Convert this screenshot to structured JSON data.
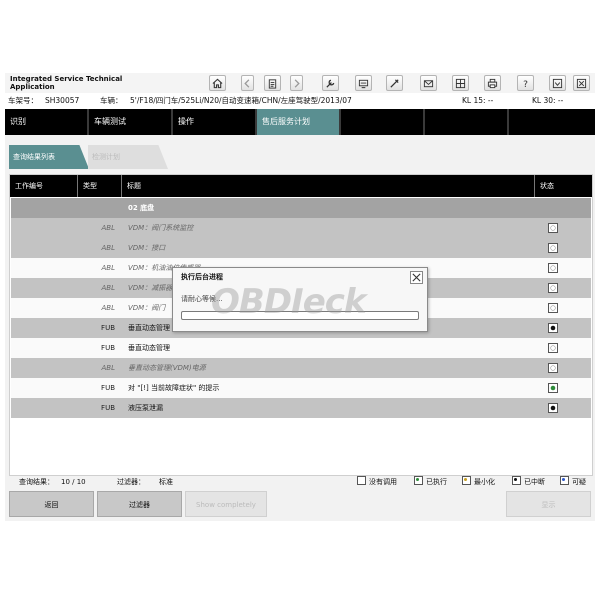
{
  "app": {
    "title": "Integrated Service Technical Application"
  },
  "vehicle": {
    "vin_label": "车架号：",
    "vin": "SH30057",
    "vehicle_label": "车辆：",
    "vehicle_desc": "5'/F18/四门车/525Li/N20/自动变速箱/CHN/左座驾驶型/2013/07",
    "kl15": "KL 15:  --",
    "kl30": "KL 30:  --"
  },
  "nav": {
    "tabs": [
      "识别",
      "车辆测试",
      "操作",
      "售后服务计划"
    ],
    "active": "售后服务计划"
  },
  "subtabs": {
    "query_results": "查询结果列表",
    "test_plan": "检测计划"
  },
  "table": {
    "headers": {
      "job_no": "工作编号",
      "type": "类型",
      "title": "标题",
      "status": "状态"
    },
    "group": "02 底盘",
    "rows": [
      {
        "type": "ABL",
        "title": "VDM：阀门系统监控",
        "style": "gray",
        "status": "empty"
      },
      {
        "type": "ABL",
        "title": "VDM：接口",
        "style": "gray",
        "status": "empty"
      },
      {
        "type": "ABL",
        "title": "VDM：机油油位传感器",
        "style": "white",
        "status": "empty"
      },
      {
        "type": "ABL",
        "title": "VDM：减振器",
        "style": "gray",
        "status": "empty"
      },
      {
        "type": "ABL",
        "title": "VDM：阀门",
        "style": "white",
        "status": "empty"
      },
      {
        "type": "FUB",
        "title": "垂直动态管理",
        "style": "gray",
        "status": "interrupted"
      },
      {
        "type": "FUB",
        "title": "垂直动态管理",
        "style": "white",
        "status": "empty"
      },
      {
        "type": "ABL",
        "title": "垂直动态管理(VDM)电源",
        "style": "gray",
        "status": "empty"
      },
      {
        "type": "FUB",
        "title": "对 \"[!] 当前故障症状\" 的提示",
        "style": "white",
        "status": "executed"
      },
      {
        "type": "FUB",
        "title": "液压泵泄漏",
        "style": "gray",
        "status": "interrupted"
      }
    ]
  },
  "footer": {
    "results_label": "查询结果：",
    "results_value": "10  /  10",
    "filter_label": "过滤器：",
    "filter_value": "标准",
    "legend": {
      "not_called": "没有调用",
      "executed": "已执行",
      "minimized": "最小化",
      "interrupted": "已中断",
      "possible": "可疑"
    }
  },
  "buttons": {
    "back": "返回",
    "filter": "过滤器",
    "show_completely": "Show completely",
    "display": "显示"
  },
  "dialog": {
    "title": "执行后台进程",
    "message": "请耐心等候..."
  },
  "watermark": "OBDIeck",
  "colors": {
    "nav_active": "#5a8f91",
    "executed": "#2e8b3a",
    "minimized": "#c8a020",
    "possible": "#2f58c8"
  },
  "icons": [
    "home-icon",
    "back-arrow-icon",
    "clipboard-icon",
    "forward-arrow-icon",
    "wrench-icon",
    "monitor-icon",
    "tool-icon",
    "mail-icon",
    "grid-icon",
    "printer-icon",
    "help-icon",
    "minimize-icon",
    "close-icon"
  ]
}
